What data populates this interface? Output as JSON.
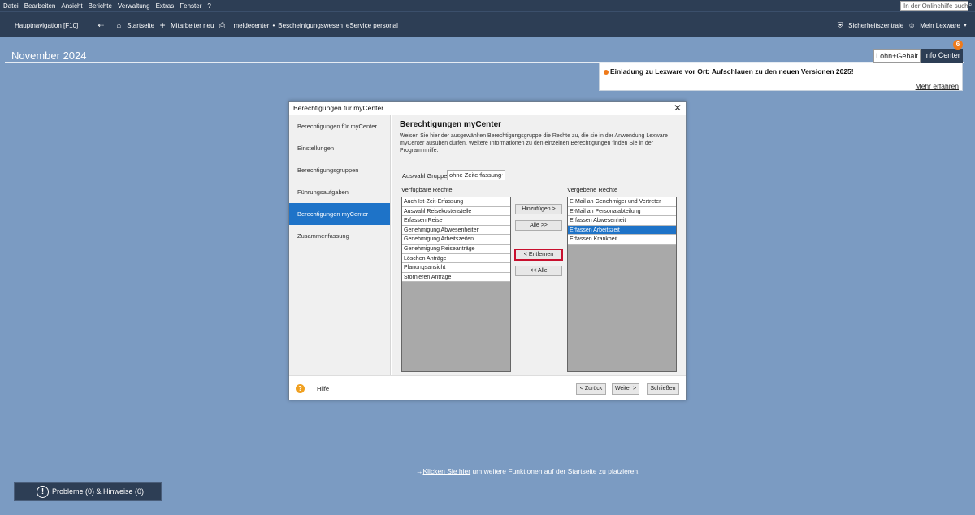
{
  "menubar": {
    "items": [
      "Datei",
      "Bearbeiten",
      "Ansicht",
      "Berichte",
      "Verwaltung",
      "Extras",
      "Fenster",
      "?"
    ],
    "help_search_placeholder": "In der Onlinehilfe suchen"
  },
  "nav": {
    "hauptnavigation": "Hauptnavigation [F10]",
    "startseite": "Startseite",
    "mitarbeiter_neu": "Mitarbeiter neu",
    "meldecenter": "meldecenter",
    "bescheinigungswesen": "Bescheinigungswesen",
    "eservice": "eService personal",
    "sicherheitszentrale": "Sicherheitszentrale",
    "mein_lexware": "Mein Lexware"
  },
  "header": {
    "date": "November 2024",
    "tab_lohn": "Lohn+Gehalt",
    "tab_info": "Info Center",
    "badge_count": "6"
  },
  "notice": {
    "text": "Einladung zu Lexware vor Ort: Aufschlauen zu den neuen Versionen 2025!",
    "link": "Mehr erfahren"
  },
  "dialog": {
    "title": "Berechtigungen für myCenter",
    "sidebar": [
      "Berechtigungen für myCenter",
      "Einstellungen",
      "Berechtigungsgruppen",
      "Führungsaufgaben",
      "Berechtigungen myCenter",
      "Zusammenfassung"
    ],
    "active_index": 4,
    "heading": "Berechtigungen myCenter",
    "description": "Weisen Sie hier der ausgewählten Berechtigungsgruppe die Rechte zu, die sie in der Anwendung Lexware myCenter ausüben dürfen. Weitere Informationen zu den einzelnen Berechtigungen finden Sie in der Programmhilfe.",
    "group_label": "Auswahl Gruppe:",
    "group_value": "ohne Zeiterfassung",
    "available_label": "Verfügbare Rechte",
    "given_label": "Vergebene Rechte",
    "available": [
      "Auch Ist-Zeit-Erfassung",
      "Auswahl Reisekostenstelle",
      "Erfassen Reise",
      "Genehmigung Abwesenheiten",
      "Genehmigung Arbeitszeiten",
      "Genehmigung Reiseanträge",
      "Löschen Anträge",
      "Planungsansicht",
      "Stornieren Anträge"
    ],
    "given": [
      "E-Mail an Genehmiger und Vertreter",
      "E-Mail an Personalabteilung",
      "Erfassen Abwesenheit",
      "Erfassen Arbeitszeit",
      "Erfassen Krankheit"
    ],
    "given_selected_index": 3,
    "btn_add": "Hinzufügen >",
    "btn_all_add": "Alle >>",
    "btn_remove": "< Entfernen",
    "btn_all_remove": "<< Alle",
    "help": "Hilfe",
    "btn_back": "< Zurück",
    "btn_next": "Weiter >",
    "btn_close": "Schließen"
  },
  "bottom": {
    "link_text": "Klicken Sie hier",
    "rest_text": " um weitere Funktionen auf der Startseite zu platzieren.",
    "problems": "Probleme (0) & Hinweise (0)"
  }
}
